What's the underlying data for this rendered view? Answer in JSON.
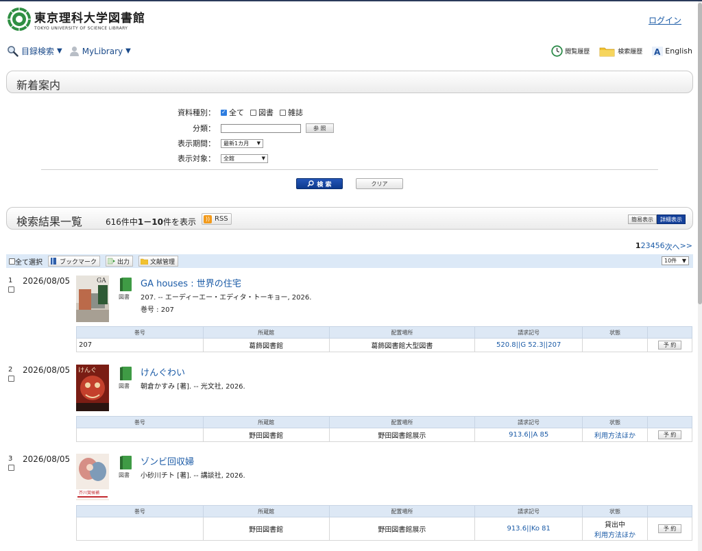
{
  "header": {
    "logo_jp": "東京理科大学図書館",
    "logo_en": "TOKYO UNIVERSITY OF SCIENCE LIBRARY",
    "login": "ログイン"
  },
  "nav": {
    "catalog_search": "目録検索",
    "mylibrary": "MyLibrary",
    "view_history": "閲覧履歴",
    "search_history": "検索履歴",
    "english": "English"
  },
  "new_arrivals": {
    "title": "新着案内"
  },
  "form": {
    "material_type_label": "資料種別：",
    "types": [
      {
        "label": "全て",
        "checked": true
      },
      {
        "label": "図書",
        "checked": false
      },
      {
        "label": "雑誌",
        "checked": false
      }
    ],
    "classification_label": "分類：",
    "classification_value": "",
    "browse_button": "参 照",
    "period_label": "表示期間：",
    "period_value": "最新1カ月",
    "target_label": "表示対象：",
    "target_value": "全館",
    "search_button": "検 索",
    "clear_button": "クリア"
  },
  "results": {
    "title": "検索結果一覧",
    "count_prefix": "616件中",
    "range": "1－10",
    "count_suffix": "件を表示",
    "rss": "RSS",
    "simple_view": "簡易表示",
    "detail_view": "詳細表示",
    "pages": [
      "1",
      "2",
      "3",
      "4",
      "5",
      "6"
    ],
    "next": "次へ",
    "last": ">>",
    "select_all": "全て選択",
    "bookmark": "ブックマーク",
    "output": "出力",
    "ref_manage": "文献管理",
    "per_page": "10件"
  },
  "holdings_headers": [
    "巻号",
    "所蔵館",
    "配置場所",
    "請求記号",
    "状態",
    ""
  ],
  "records": [
    {
      "num": "1",
      "date": "2026/08/05",
      "type": "図書",
      "title": "GA houses : 世界の住宅",
      "meta": "207. -- エーディーエー・エディタ・トーキョー, 2026.",
      "vol": "巻号 : 207",
      "holding": {
        "volume": "207",
        "library": "葛飾図書館",
        "location": "葛飾図書館大型図書",
        "callno": "520.8||G 52.3||207",
        "status1": "",
        "status2": "",
        "reserve": "予 約"
      }
    },
    {
      "num": "2",
      "date": "2026/08/05",
      "type": "図書",
      "title": "けんぐわい",
      "meta": "朝倉かすみ [著]. -- 光文社, 2026.",
      "vol": "",
      "holding": {
        "volume": "",
        "library": "野田図書館",
        "location": "野田図書館展示",
        "callno": "913.6||A 85",
        "status1": "",
        "status2": "利用方法ほか",
        "reserve": "予 約"
      }
    },
    {
      "num": "3",
      "date": "2026/08/05",
      "type": "図書",
      "title": "ゾンビ回収婦",
      "meta": "小砂川チト [著]. -- 講談社, 2026.",
      "vol": "",
      "cover_band": "芥川賞候補",
      "holding": {
        "volume": "",
        "library": "野田図書館",
        "location": "野田図書館展示",
        "callno": "913.6||Ko 81",
        "status1": "貸出中",
        "status2": "利用方法ほか",
        "reserve": "予 約"
      }
    }
  ]
}
